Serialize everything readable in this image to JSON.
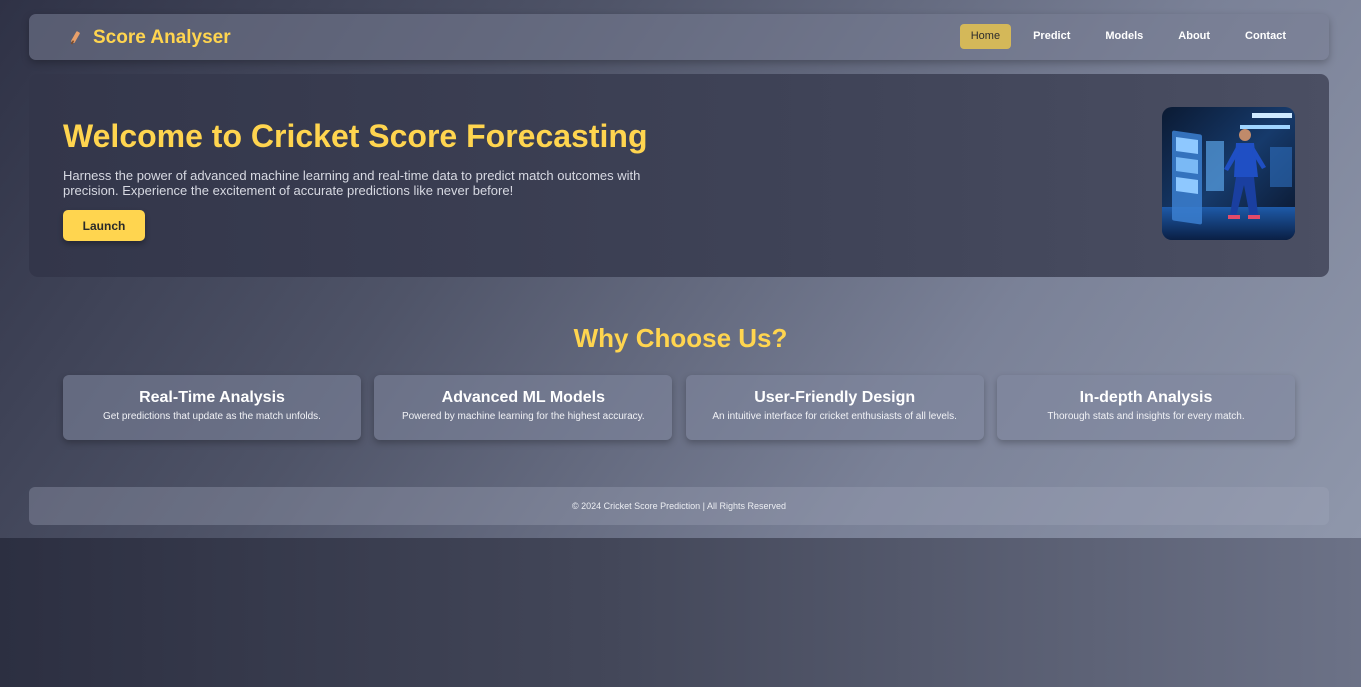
{
  "nav": {
    "brand": "Score Analyser",
    "brand_icon": "cricket-bat-icon",
    "links": [
      "Home",
      "Predict",
      "Models",
      "About",
      "Contact"
    ],
    "active": "Home"
  },
  "hero": {
    "title": "Welcome to Cricket Score Forecasting",
    "description": "Harness the power of advanced machine learning and real-time data to predict match outcomes with precision. Experience the excitement of accurate predictions like never before!",
    "button_label": "Launch"
  },
  "features": {
    "heading": "Why Choose Us?",
    "items": [
      {
        "title": "Real-Time Analysis",
        "desc": "Get predictions that update as the match unfolds."
      },
      {
        "title": "Advanced ML Models",
        "desc": "Powered by machine learning for the highest accuracy."
      },
      {
        "title": "User-Friendly Design",
        "desc": "An intuitive interface for cricket enthusiasts of all levels."
      },
      {
        "title": "In-depth Analysis",
        "desc": "Thorough stats and insights for every match."
      }
    ]
  },
  "footer": {
    "text": "© 2024 Cricket Score Prediction | All Rights Reserved"
  },
  "colors": {
    "accent": "#ffd54f",
    "active_nav": "#d4b859"
  }
}
